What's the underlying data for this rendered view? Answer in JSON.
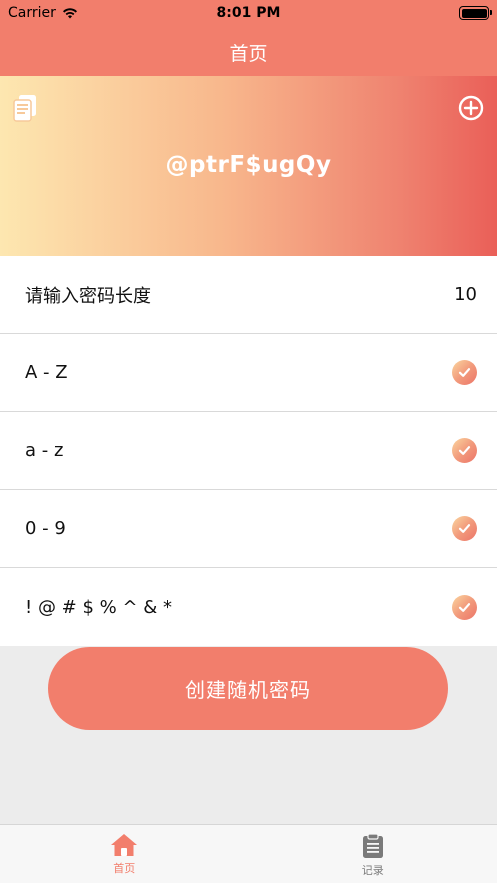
{
  "status_bar": {
    "carrier": "Carrier",
    "time": "8:01 PM"
  },
  "nav": {
    "title": "首页"
  },
  "banner": {
    "password": "@ptrF$ugQy"
  },
  "options": {
    "length_label": "请输入密码长度",
    "length_value": "10",
    "items": [
      {
        "label": "A - Z",
        "checked": true
      },
      {
        "label": "a - z",
        "checked": true
      },
      {
        "label": "0 - 9",
        "checked": true
      },
      {
        "label": "! @ # $ % ^ & *",
        "checked": true
      }
    ]
  },
  "create_button": {
    "label": "创建随机密码"
  },
  "tabs": [
    {
      "label": "首页",
      "icon": "home-icon",
      "active": true
    },
    {
      "label": "记录",
      "icon": "clipboard-icon",
      "active": false
    }
  ],
  "colors": {
    "accent": "#f27e6c",
    "gradient": [
      "#fde7b0",
      "#ea5f58"
    ],
    "tab_inactive": "#7a7a7a"
  }
}
